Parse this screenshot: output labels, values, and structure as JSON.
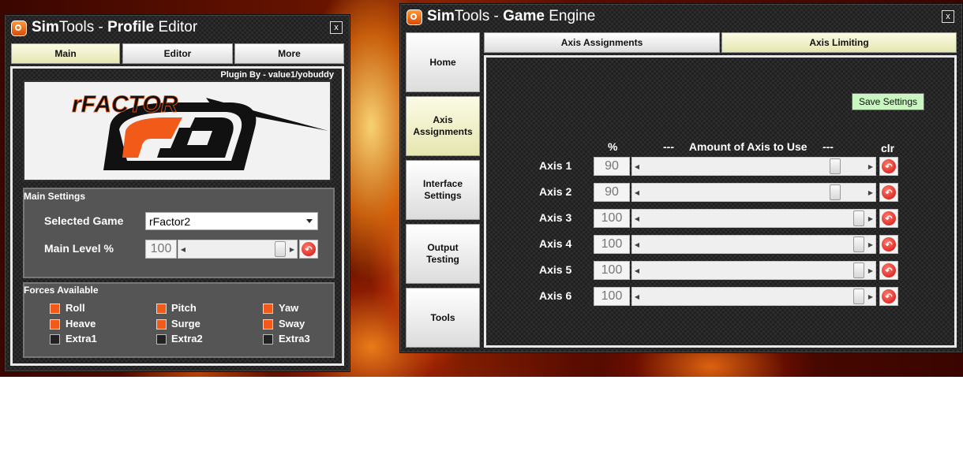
{
  "profile_editor": {
    "title_part1": "Sim",
    "title_part2": "Tools - ",
    "title_part3": "Profile",
    "title_part4": " Editor",
    "close": "x",
    "tabs": [
      {
        "label": "Main",
        "active": true
      },
      {
        "label": "Editor",
        "active": false
      },
      {
        "label": "More",
        "active": false
      }
    ],
    "plugin_by": "Plugin By - value1/yobuddy",
    "logo_text": "rFactor 2",
    "main_settings": {
      "group_label": "Main Settings",
      "selected_game_label": "Selected Game",
      "selected_game_value": "rFactor2",
      "main_level_label": "Main Level %",
      "main_level_value": "100"
    },
    "forces": {
      "group_label": "Forces Available",
      "items": [
        {
          "label": "Roll",
          "checked": true
        },
        {
          "label": "Pitch",
          "checked": true
        },
        {
          "label": "Yaw",
          "checked": true
        },
        {
          "label": "Heave",
          "checked": true
        },
        {
          "label": "Surge",
          "checked": true
        },
        {
          "label": "Sway",
          "checked": true
        },
        {
          "label": "Extra1",
          "checked": false
        },
        {
          "label": "Extra2",
          "checked": false
        },
        {
          "label": "Extra3",
          "checked": false
        }
      ]
    }
  },
  "game_engine": {
    "title_part1": "Sim",
    "title_part2": "Tools - ",
    "title_part3": "Game",
    "title_part4": " Engine",
    "close": "x",
    "side_nav": [
      {
        "label": "Home",
        "active": false
      },
      {
        "label": "Axis Assignments",
        "active": true
      },
      {
        "label": "Interface Settings",
        "active": false
      },
      {
        "label": "Output Testing",
        "active": false
      },
      {
        "label": "Tools",
        "active": false
      }
    ],
    "tabs": [
      {
        "label": "Axis Assignments",
        "active": false
      },
      {
        "label": "Axis Limiting",
        "active": true
      }
    ],
    "save_settings": "Save Settings",
    "header_percent": "%",
    "header_amount": "---     Amount of Axis to Use     ---",
    "header_clr": "clr",
    "axes": [
      {
        "label": "Axis 1",
        "value": "90"
      },
      {
        "label": "Axis 2",
        "value": "90"
      },
      {
        "label": "Axis 3",
        "value": "100"
      },
      {
        "label": "Axis 4",
        "value": "100"
      },
      {
        "label": "Axis 5",
        "value": "100"
      },
      {
        "label": "Axis 6",
        "value": "100"
      }
    ]
  },
  "colors": {
    "accent_orange": "#f25a1a",
    "active_button": "#f0f0c8",
    "save_button": "#c8f5c0",
    "reset_red": "#d01010"
  }
}
